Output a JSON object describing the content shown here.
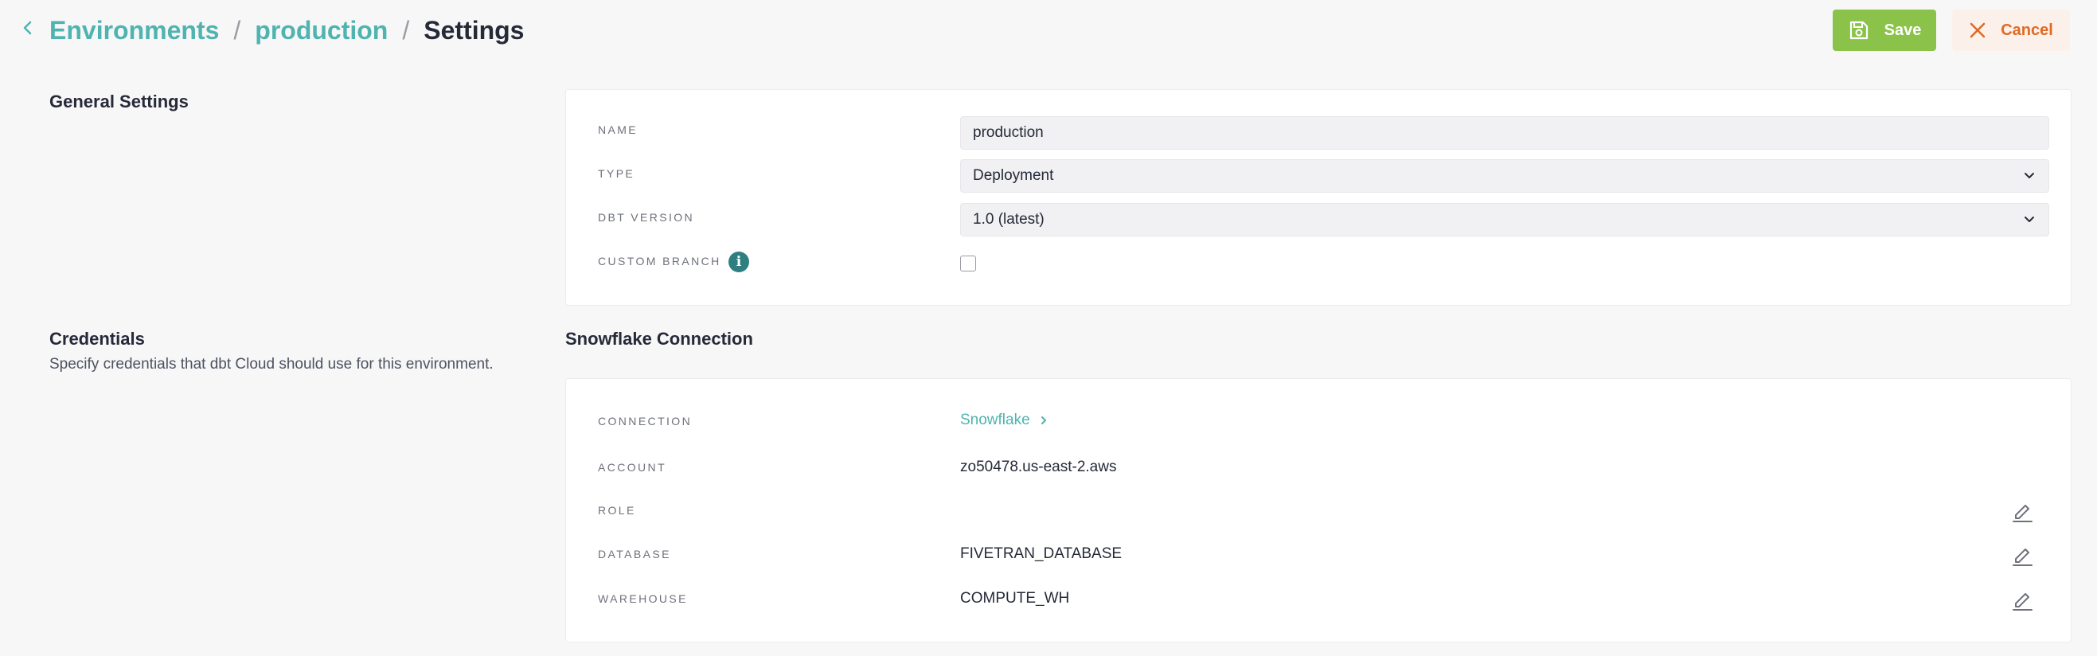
{
  "header": {
    "breadcrumb": [
      {
        "label": "Environments"
      },
      {
        "label": "production"
      },
      {
        "label": "Settings"
      }
    ],
    "separator": "/",
    "save_label": "Save",
    "cancel_label": "Cancel"
  },
  "general_settings": {
    "title": "General Settings",
    "fields": {
      "name": {
        "label": "NAME",
        "value": "production"
      },
      "type": {
        "label": "TYPE",
        "value": "Deployment"
      },
      "dbt_version": {
        "label": "DBT VERSION",
        "value": "1.0 (latest)"
      },
      "custom_branch": {
        "label": "CUSTOM BRANCH",
        "checked": false
      }
    }
  },
  "credentials": {
    "title": "Credentials",
    "description": "Specify credentials that dbt Cloud should use for this environment.",
    "connection_title": "Snowflake Connection",
    "fields": {
      "connection": {
        "label": "CONNECTION",
        "value": "Snowflake"
      },
      "account": {
        "label": "ACCOUNT",
        "value": "zo50478.us-east-2.aws"
      },
      "role": {
        "label": "ROLE",
        "value": ""
      },
      "database": {
        "label": "DATABASE",
        "value": "FIVETRAN_DATABASE"
      },
      "warehouse": {
        "label": "WAREHOUSE",
        "value": "COMPUTE_WH"
      }
    }
  },
  "colors": {
    "accent": "#4fb3b0",
    "save": "#8bc34a",
    "cancel": "#e06a24",
    "info": "#2f7f80"
  },
  "icons": [
    "chevron-left-icon",
    "save-icon",
    "close-icon",
    "info-icon",
    "chevron-down-icon",
    "chevron-right-icon",
    "edit-icon"
  ]
}
